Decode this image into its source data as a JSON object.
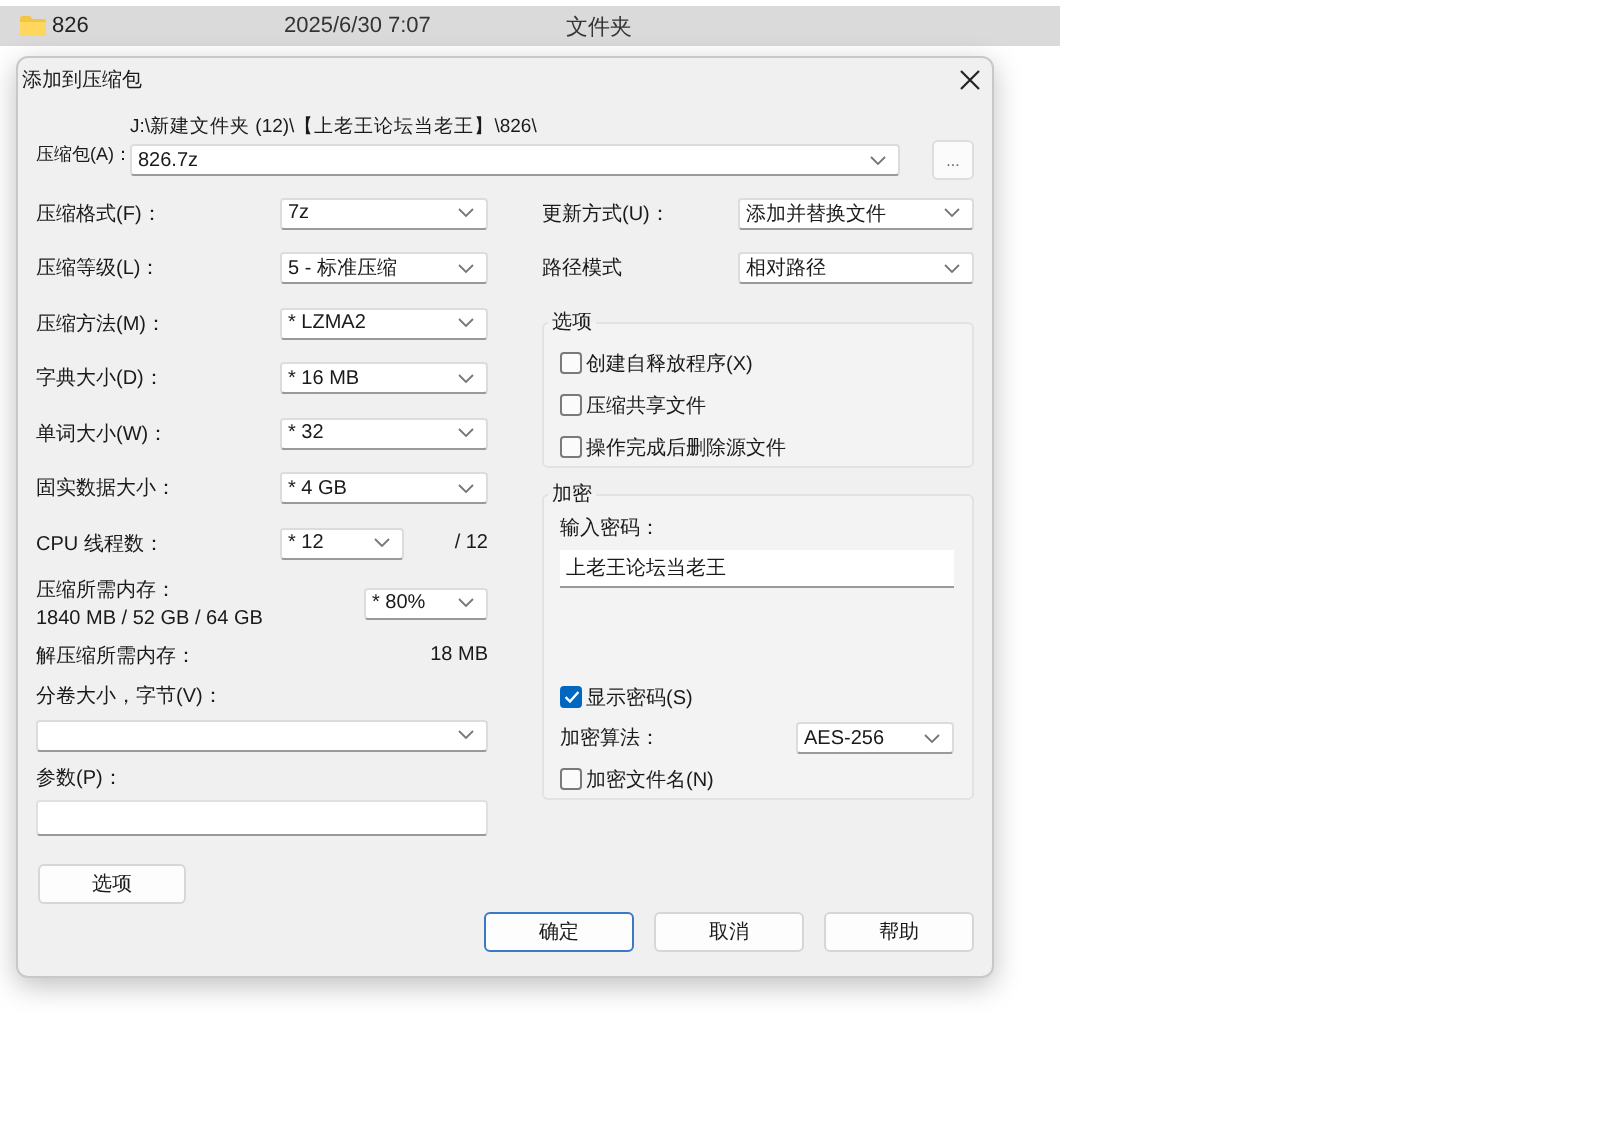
{
  "file_row": {
    "name": "826",
    "date": "2025/6/30 7:07",
    "type": "文件夹",
    "selected": true
  },
  "dialog": {
    "title": "添加到压缩包",
    "archive": {
      "label": "压缩包(A)：",
      "path": "J:\\新建文件夹 (12)\\【上老王论坛当老王】\\826\\",
      "value": "826.7z",
      "browse": "..."
    },
    "settings": [
      {
        "label": "压缩格式(F)：",
        "value": "7z"
      },
      {
        "label": "压缩等级(L)：",
        "value": "5 - 标准压缩"
      },
      {
        "label": "压缩方法(M)：",
        "value": "* LZMA2"
      },
      {
        "label": "字典大小(D)：",
        "value": "* 16 MB"
      },
      {
        "label": "单词大小(W)：",
        "value": "* 32"
      },
      {
        "label": "固实数据大小：",
        "value": "* 4 GB"
      },
      {
        "label": "CPU 线程数：",
        "value": "* 12",
        "suffix": "/ 12"
      }
    ],
    "memory": {
      "label": "压缩所需内存：",
      "detail": "1840 MB / 52 GB / 64 GB",
      "value": "* 80%"
    },
    "decompress": {
      "label": "解压缩所需内存：",
      "value": "18 MB"
    },
    "volume": {
      "label": "分卷大小，字节(V)："
    },
    "params": {
      "label": "参数(P)："
    },
    "options_button": "选项",
    "update": {
      "label": "更新方式(U)：",
      "value": "添加并替换文件"
    },
    "path_mode": {
      "label": "路径模式",
      "value": "相对路径"
    },
    "options_group": {
      "title": "选项",
      "items": [
        {
          "label": "创建自释放程序(X)",
          "checked": false
        },
        {
          "label": "压缩共享文件",
          "checked": false
        },
        {
          "label": "操作完成后删除源文件",
          "checked": false
        }
      ]
    },
    "encryption": {
      "title": "加密",
      "password_label": "输入密码：",
      "password": "上老王论坛当老王",
      "show_password": {
        "label": "显示密码(S)",
        "checked": true
      },
      "method": {
        "label": "加密算法：",
        "value": "AES-256"
      },
      "encrypt_names": {
        "label": "加密文件名(N)",
        "checked": false
      }
    },
    "buttons": [
      {
        "label": "确定",
        "focused": true
      },
      {
        "label": "取消",
        "focused": false
      },
      {
        "label": "帮助",
        "focused": false
      }
    ]
  }
}
